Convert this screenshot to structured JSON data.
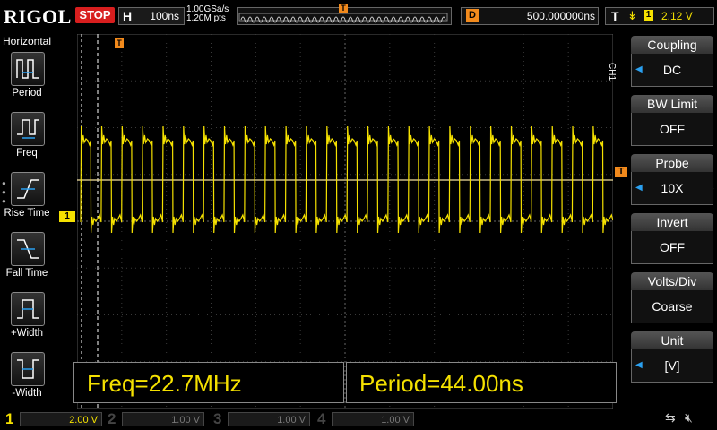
{
  "header": {
    "logo": "RIGOL",
    "run_state": "STOP",
    "horizontal_letter": "H",
    "timebase": "100ns",
    "sample_rate": "1.00GSa/s",
    "memory_depth": "1.20M pts",
    "trigger_marker": "T",
    "delay_letter": "D",
    "delay_value": "500.000000ns",
    "trigger_letter": "T",
    "trigger_slope_icon": "rising-edge-icon",
    "trigger_source": "1",
    "trigger_level": "2.12 V"
  },
  "left_menu": {
    "title": "Horizontal",
    "items": [
      {
        "label": "Period",
        "icon": "period-icon"
      },
      {
        "label": "Freq",
        "icon": "freq-icon"
      },
      {
        "label": "Rise Time",
        "icon": "rise-time-icon"
      },
      {
        "label": "Fall Time",
        "icon": "fall-time-icon"
      },
      {
        "label": "+Width",
        "icon": "positive-width-icon"
      },
      {
        "label": "-Width",
        "icon": "negative-width-icon"
      }
    ]
  },
  "right_menu": {
    "channel_label": "CH1",
    "items": [
      {
        "title": "Coupling",
        "value": "DC"
      },
      {
        "title": "BW Limit",
        "value": "OFF"
      },
      {
        "title": "Probe",
        "value": "10X"
      },
      {
        "title": "Invert",
        "value": "OFF"
      },
      {
        "title": "Volts/Div",
        "value": "Coarse"
      },
      {
        "title": "Unit",
        "value": "[V]"
      }
    ]
  },
  "measurements": [
    {
      "text": "Freq=22.7MHz"
    },
    {
      "text": "Period=44.00ns"
    }
  ],
  "channels": [
    {
      "num": "1",
      "scale": "2.00 V",
      "color": "#f5e100"
    },
    {
      "num": "2",
      "scale": "1.00 V",
      "color": "#1fd4d4"
    },
    {
      "num": "3",
      "scale": "1.00 V",
      "color": "#e040e0"
    },
    {
      "num": "4",
      "scale": "1.00 V",
      "color": "#3a8cff"
    }
  ],
  "markers": {
    "trigger_pos": "T",
    "ch1_ground": "1",
    "trigger_level_marker": "T"
  },
  "colors": {
    "ch1": "#f5e100",
    "trigger": "#f28a1c",
    "stop": "#d81e1e"
  }
}
